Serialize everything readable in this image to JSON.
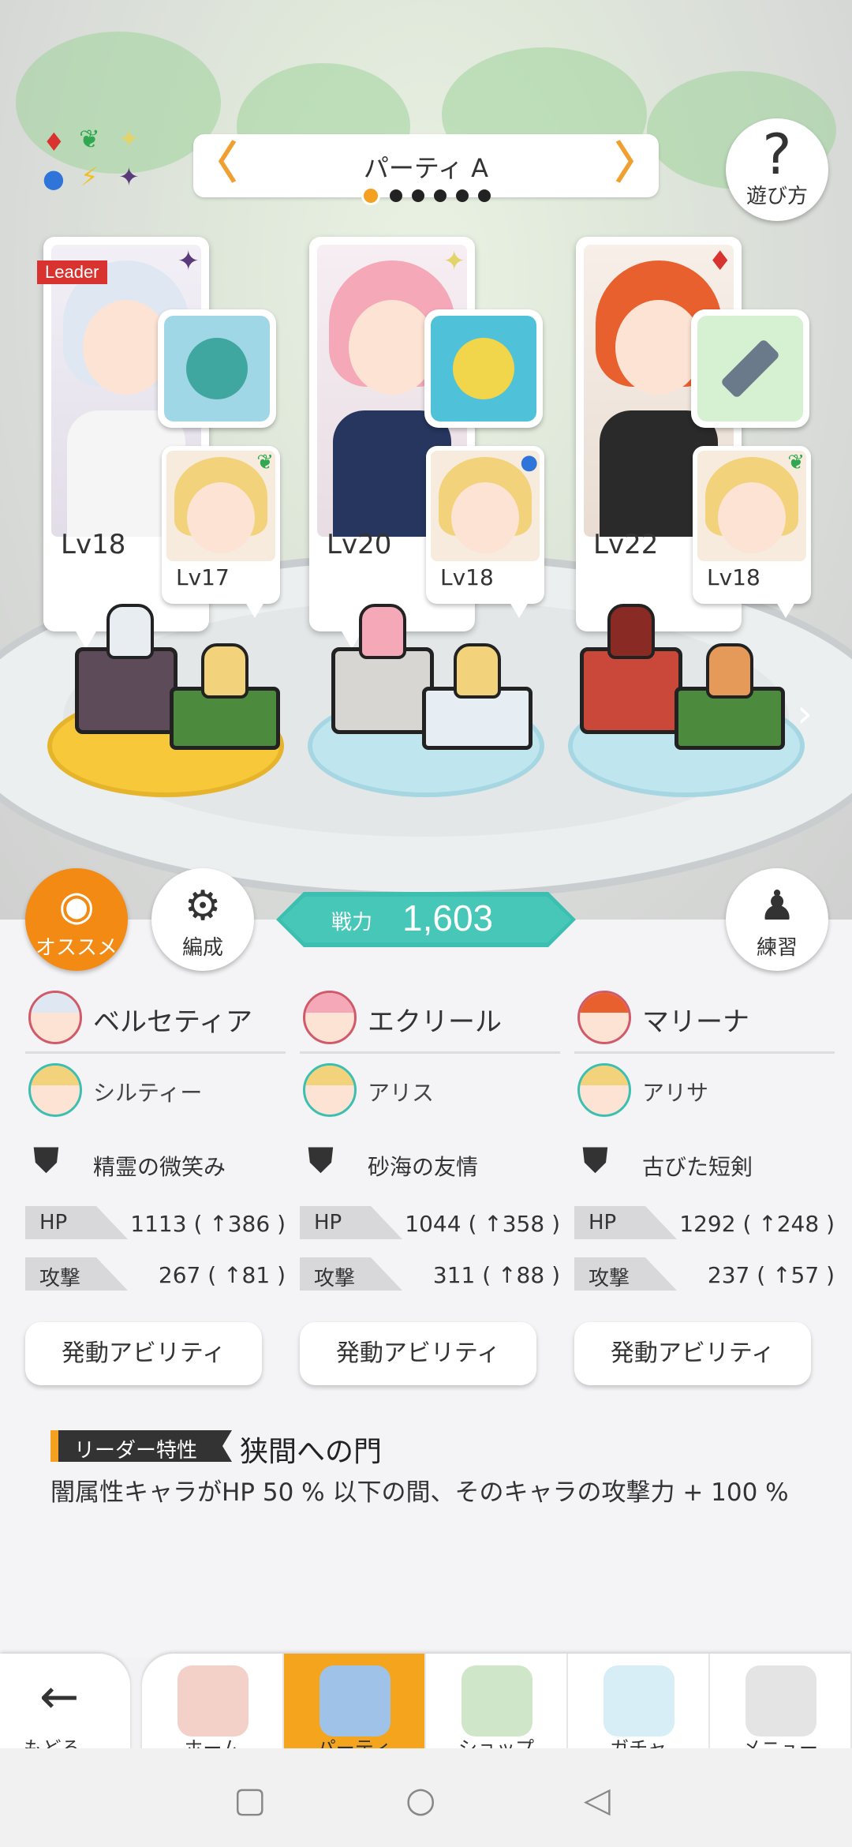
{
  "party": {
    "title": "パーティ A",
    "page_count": 6,
    "active_page": 1
  },
  "help": {
    "label": "遊び方"
  },
  "characters": [
    {
      "name": "ベルセティア",
      "level": "Lv18",
      "leader_tag": "Leader",
      "attr_icon": "dark-star-icon",
      "hair": "#dfe8f2",
      "outfit": "#f5f5f5",
      "bg": "#f2eff7",
      "equip_color": "#3fa7a0",
      "equip_bg": "#ffd84a",
      "sub": {
        "name": "シルティー",
        "level": "Lv17",
        "attr_icon": "wind-leaf-icon"
      },
      "equip_name": "精霊の微笑み",
      "hp": "1113 ( ↑386 )",
      "atk": "267 ( ↑81 )"
    },
    {
      "name": "エクリール",
      "level": "Lv20",
      "attr_icon": "light-star-icon",
      "hair": "#f4a8b8",
      "outfit": "#26365e",
      "bg": "#f6eef2",
      "equip_color": "#f1d54a",
      "equip_bg": "#4fc1d8",
      "sub": {
        "name": "アリス",
        "level": "Lv18",
        "attr_icon": "water-circle-icon"
      },
      "equip_name": "砂海の友情",
      "hp": "1044 ( ↑358 )",
      "atk": "311 ( ↑88 )"
    },
    {
      "name": "マリーナ",
      "level": "Lv22",
      "attr_icon": "fire-diamond-icon",
      "hair": "#e8602e",
      "outfit": "#2a2a2a",
      "bg": "#f7efe8",
      "equip_color": "#6a7a8a",
      "equip_bg": "#d6f1d2",
      "sub": {
        "name": "アリサ",
        "level": "Lv18",
        "attr_icon": "wind-leaf-icon"
      },
      "equip_name": "古びた短剣",
      "hp": "1292 ( ↑248 )",
      "atk": "237 ( ↑57 )"
    }
  ],
  "buttons": {
    "recommend": "オススメ",
    "formation": "編成",
    "practice": "練習",
    "ability": "発動アビリティ"
  },
  "power": {
    "label": "戦力",
    "value": "1,603"
  },
  "stat_labels": {
    "hp": "HP",
    "atk": "攻撃"
  },
  "leader_skill": {
    "badge": "リーダー特性",
    "name": "狭間への門",
    "description": "闇属性キャラがHP 50 % 以下の間、そのキャラの攻撃力 + 100 %"
  },
  "nav": {
    "back_label": "もどる",
    "tabs": [
      {
        "label": "ホーム",
        "icon": "home-icon",
        "color": "#e34d3a"
      },
      {
        "label": "パーティ",
        "icon": "party-icon",
        "color": "#3a6ed8"
      },
      {
        "label": "ショップ",
        "icon": "shop-icon",
        "color": "#4aa64e"
      },
      {
        "label": "ガチャ",
        "icon": "gacha-icon",
        "color": "#7fd0e8"
      },
      {
        "label": "メニュー",
        "icon": "menu-icon",
        "color": "#555555"
      }
    ]
  },
  "element_chart": [
    "♦",
    "❦",
    "✦",
    "●",
    "⚡",
    "✦"
  ]
}
